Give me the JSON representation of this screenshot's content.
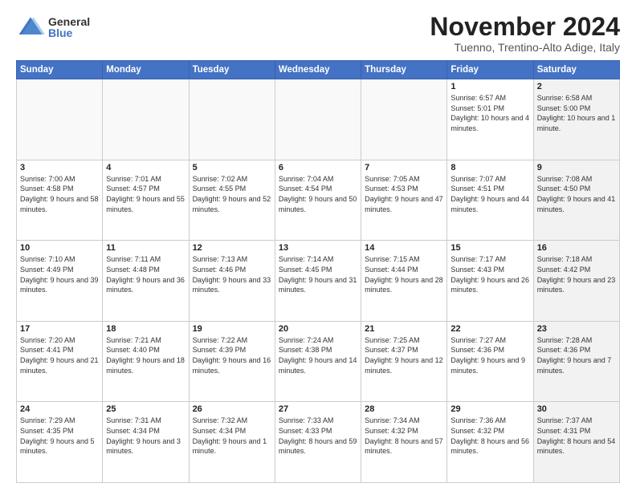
{
  "header": {
    "logo_general": "General",
    "logo_blue": "Blue",
    "month_title": "November 2024",
    "location": "Tuenno, Trentino-Alto Adige, Italy"
  },
  "weekdays": [
    "Sunday",
    "Monday",
    "Tuesday",
    "Wednesday",
    "Thursday",
    "Friday",
    "Saturday"
  ],
  "weeks": [
    [
      {
        "day": "",
        "info": "",
        "shaded": true
      },
      {
        "day": "",
        "info": "",
        "shaded": true
      },
      {
        "day": "",
        "info": "",
        "shaded": true
      },
      {
        "day": "",
        "info": "",
        "shaded": true
      },
      {
        "day": "",
        "info": "",
        "shaded": true
      },
      {
        "day": "1",
        "info": "Sunrise: 6:57 AM\nSunset: 5:01 PM\nDaylight: 10 hours and 4 minutes.",
        "shaded": false
      },
      {
        "day": "2",
        "info": "Sunrise: 6:58 AM\nSunset: 5:00 PM\nDaylight: 10 hours and 1 minute.",
        "shaded": true
      }
    ],
    [
      {
        "day": "3",
        "info": "Sunrise: 7:00 AM\nSunset: 4:58 PM\nDaylight: 9 hours and 58 minutes.",
        "shaded": false
      },
      {
        "day": "4",
        "info": "Sunrise: 7:01 AM\nSunset: 4:57 PM\nDaylight: 9 hours and 55 minutes.",
        "shaded": false
      },
      {
        "day": "5",
        "info": "Sunrise: 7:02 AM\nSunset: 4:55 PM\nDaylight: 9 hours and 52 minutes.",
        "shaded": false
      },
      {
        "day": "6",
        "info": "Sunrise: 7:04 AM\nSunset: 4:54 PM\nDaylight: 9 hours and 50 minutes.",
        "shaded": false
      },
      {
        "day": "7",
        "info": "Sunrise: 7:05 AM\nSunset: 4:53 PM\nDaylight: 9 hours and 47 minutes.",
        "shaded": false
      },
      {
        "day": "8",
        "info": "Sunrise: 7:07 AM\nSunset: 4:51 PM\nDaylight: 9 hours and 44 minutes.",
        "shaded": false
      },
      {
        "day": "9",
        "info": "Sunrise: 7:08 AM\nSunset: 4:50 PM\nDaylight: 9 hours and 41 minutes.",
        "shaded": true
      }
    ],
    [
      {
        "day": "10",
        "info": "Sunrise: 7:10 AM\nSunset: 4:49 PM\nDaylight: 9 hours and 39 minutes.",
        "shaded": false
      },
      {
        "day": "11",
        "info": "Sunrise: 7:11 AM\nSunset: 4:48 PM\nDaylight: 9 hours and 36 minutes.",
        "shaded": false
      },
      {
        "day": "12",
        "info": "Sunrise: 7:13 AM\nSunset: 4:46 PM\nDaylight: 9 hours and 33 minutes.",
        "shaded": false
      },
      {
        "day": "13",
        "info": "Sunrise: 7:14 AM\nSunset: 4:45 PM\nDaylight: 9 hours and 31 minutes.",
        "shaded": false
      },
      {
        "day": "14",
        "info": "Sunrise: 7:15 AM\nSunset: 4:44 PM\nDaylight: 9 hours and 28 minutes.",
        "shaded": false
      },
      {
        "day": "15",
        "info": "Sunrise: 7:17 AM\nSunset: 4:43 PM\nDaylight: 9 hours and 26 minutes.",
        "shaded": false
      },
      {
        "day": "16",
        "info": "Sunrise: 7:18 AM\nSunset: 4:42 PM\nDaylight: 9 hours and 23 minutes.",
        "shaded": true
      }
    ],
    [
      {
        "day": "17",
        "info": "Sunrise: 7:20 AM\nSunset: 4:41 PM\nDaylight: 9 hours and 21 minutes.",
        "shaded": false
      },
      {
        "day": "18",
        "info": "Sunrise: 7:21 AM\nSunset: 4:40 PM\nDaylight: 9 hours and 18 minutes.",
        "shaded": false
      },
      {
        "day": "19",
        "info": "Sunrise: 7:22 AM\nSunset: 4:39 PM\nDaylight: 9 hours and 16 minutes.",
        "shaded": false
      },
      {
        "day": "20",
        "info": "Sunrise: 7:24 AM\nSunset: 4:38 PM\nDaylight: 9 hours and 14 minutes.",
        "shaded": false
      },
      {
        "day": "21",
        "info": "Sunrise: 7:25 AM\nSunset: 4:37 PM\nDaylight: 9 hours and 12 minutes.",
        "shaded": false
      },
      {
        "day": "22",
        "info": "Sunrise: 7:27 AM\nSunset: 4:36 PM\nDaylight: 9 hours and 9 minutes.",
        "shaded": false
      },
      {
        "day": "23",
        "info": "Sunrise: 7:28 AM\nSunset: 4:36 PM\nDaylight: 9 hours and 7 minutes.",
        "shaded": true
      }
    ],
    [
      {
        "day": "24",
        "info": "Sunrise: 7:29 AM\nSunset: 4:35 PM\nDaylight: 9 hours and 5 minutes.",
        "shaded": false
      },
      {
        "day": "25",
        "info": "Sunrise: 7:31 AM\nSunset: 4:34 PM\nDaylight: 9 hours and 3 minutes.",
        "shaded": false
      },
      {
        "day": "26",
        "info": "Sunrise: 7:32 AM\nSunset: 4:34 PM\nDaylight: 9 hours and 1 minute.",
        "shaded": false
      },
      {
        "day": "27",
        "info": "Sunrise: 7:33 AM\nSunset: 4:33 PM\nDaylight: 8 hours and 59 minutes.",
        "shaded": false
      },
      {
        "day": "28",
        "info": "Sunrise: 7:34 AM\nSunset: 4:32 PM\nDaylight: 8 hours and 57 minutes.",
        "shaded": false
      },
      {
        "day": "29",
        "info": "Sunrise: 7:36 AM\nSunset: 4:32 PM\nDaylight: 8 hours and 56 minutes.",
        "shaded": false
      },
      {
        "day": "30",
        "info": "Sunrise: 7:37 AM\nSunset: 4:31 PM\nDaylight: 8 hours and 54 minutes.",
        "shaded": true
      }
    ]
  ]
}
